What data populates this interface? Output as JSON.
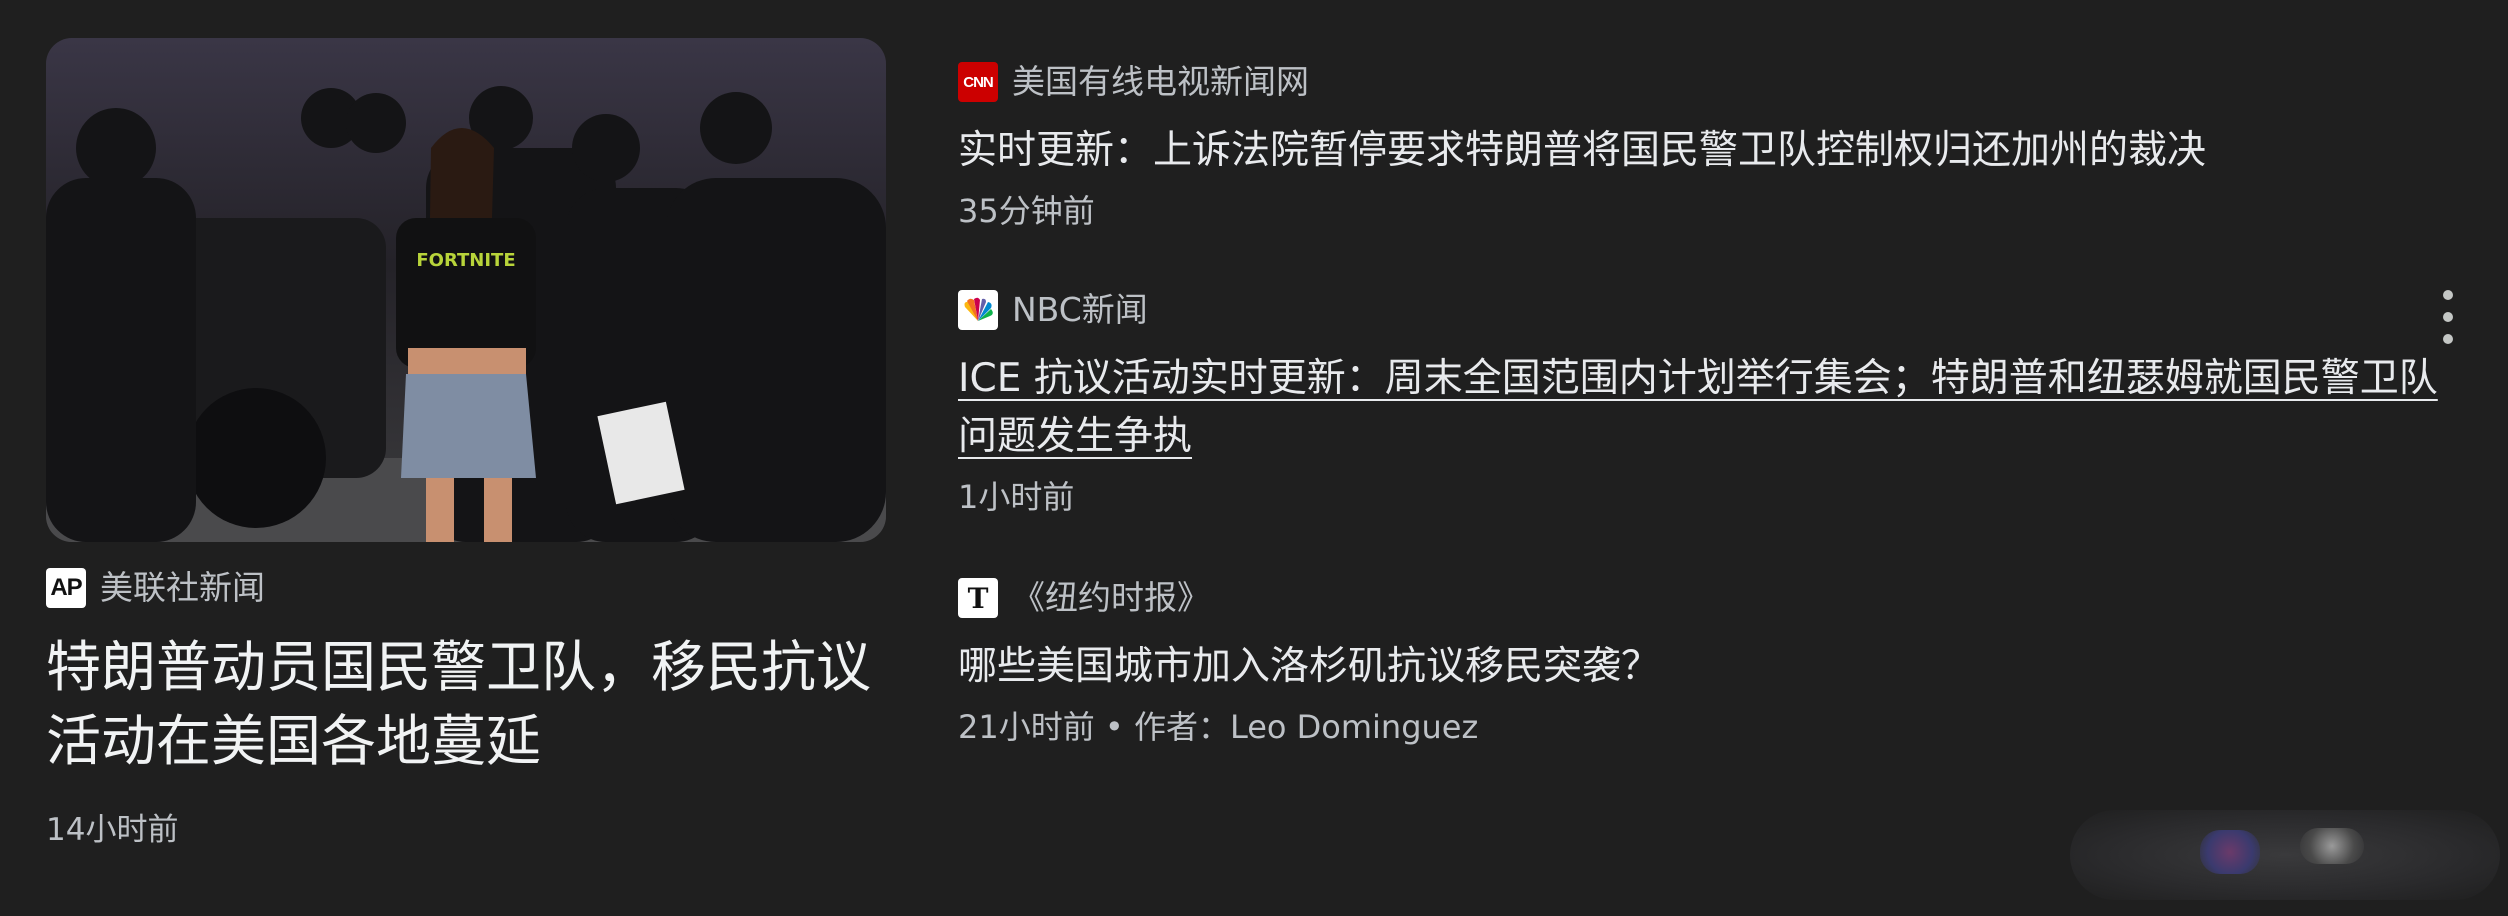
{
  "lead_story": {
    "source": "美联社新闻",
    "source_logo_text": "AP",
    "title": "特朗普动员国民警卫队，移民抗议活动在美国各地蔓延",
    "time": "14小时前",
    "image_shirt_text": "FORTNITE"
  },
  "stories": [
    {
      "source": "美国有线电视新闻网",
      "logo_text": "CNN",
      "title": "实时更新：上诉法院暂停要求特朗普将国民警卫队控制权归还加州的裁决",
      "meta": "35分钟前"
    },
    {
      "source": "NBC新闻",
      "logo_icon": "nbc-peacock-icon",
      "title": "ICE 抗议活动实时更新：周末全国范围内计划举行集会；特朗普和纽瑟姆就国民警卫队问题发生争执",
      "meta": "1小时前"
    },
    {
      "source": "《纽约时报》",
      "logo_text": "T",
      "title": "哪些美国城市加入洛杉矶抗议移民突袭？",
      "meta": "21小时前 • 作者：Leo Dominguez"
    }
  ],
  "icons": {
    "more": "more-vert-icon"
  },
  "colors": {
    "background": "#1f1f1f",
    "cnn_red": "#cc0000",
    "ap_red": "#e4002b",
    "text_primary": "#e8eaed",
    "text_secondary": "#bdc1c6"
  }
}
